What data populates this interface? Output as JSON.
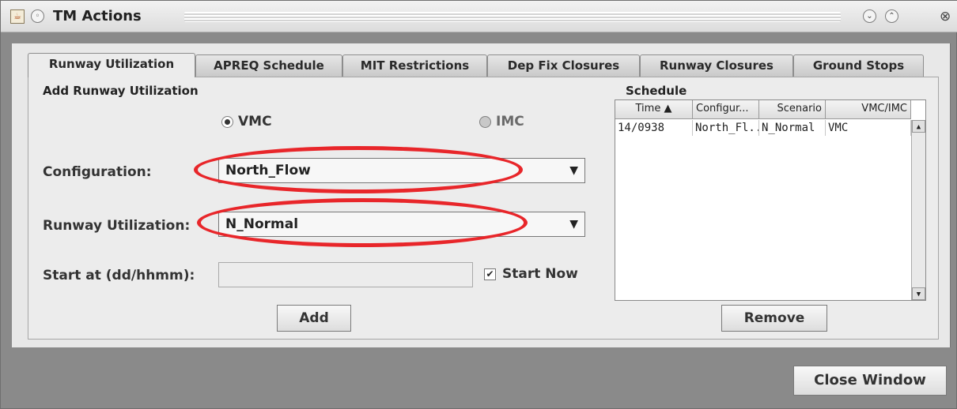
{
  "window": {
    "title": "TM Actions"
  },
  "tabs": [
    {
      "label": "Runway Utilization",
      "active": true
    },
    {
      "label": "APREQ Schedule"
    },
    {
      "label": "MIT Restrictions"
    },
    {
      "label": "Dep Fix Closures"
    },
    {
      "label": "Runway Closures"
    },
    {
      "label": "Ground Stops"
    }
  ],
  "form": {
    "section_title": "Add Runway Utilization",
    "radio_vmc": "VMC",
    "radio_imc": "IMC",
    "configuration_label": "Configuration:",
    "configuration_value": "North_Flow",
    "runway_util_label": "Runway Utilization:",
    "runway_util_value": "N_Normal",
    "start_label": "Start at (dd/hhmm):",
    "start_value": "",
    "start_now_label": "Start Now",
    "add_button": "Add"
  },
  "schedule": {
    "title": "Schedule",
    "columns": [
      "Time ▲",
      "Configur...",
      "Scenario",
      "VMC/IMC"
    ],
    "rows": [
      [
        "14/0938",
        "North_Fl...",
        "N_Normal",
        "VMC"
      ]
    ],
    "remove_button": "Remove"
  },
  "footer": {
    "close_button": "Close Window"
  },
  "colors": {
    "annotation": "#e8262a"
  }
}
